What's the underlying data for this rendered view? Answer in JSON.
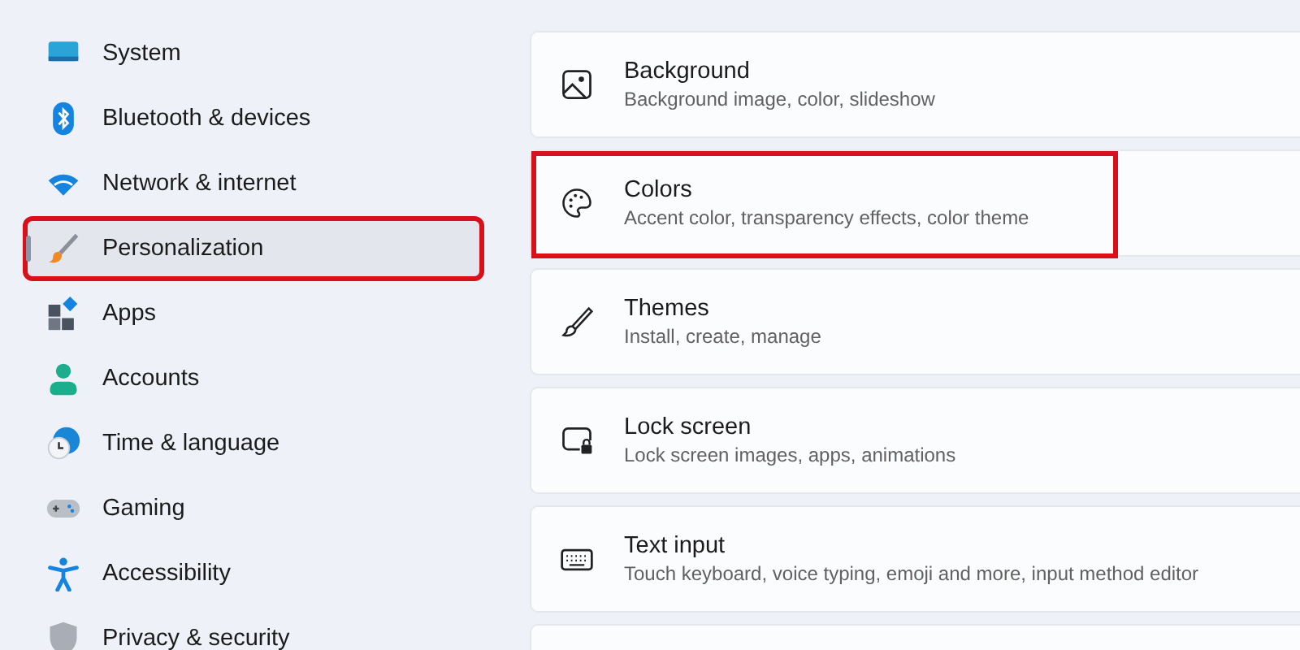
{
  "sidebar": {
    "items": [
      {
        "label": "System",
        "selected": false,
        "highlighted": false
      },
      {
        "label": "Bluetooth & devices",
        "selected": false,
        "highlighted": false
      },
      {
        "label": "Network & internet",
        "selected": false,
        "highlighted": false
      },
      {
        "label": "Personalization",
        "selected": true,
        "highlighted": true
      },
      {
        "label": "Apps",
        "selected": false,
        "highlighted": false
      },
      {
        "label": "Accounts",
        "selected": false,
        "highlighted": false
      },
      {
        "label": "Time & language",
        "selected": false,
        "highlighted": false
      },
      {
        "label": "Gaming",
        "selected": false,
        "highlighted": false
      },
      {
        "label": "Accessibility",
        "selected": false,
        "highlighted": false
      },
      {
        "label": "Privacy & security",
        "selected": false,
        "highlighted": false
      }
    ]
  },
  "cards": [
    {
      "title": "Background",
      "subtitle": "Background image, color, slideshow",
      "highlighted": false
    },
    {
      "title": "Colors",
      "subtitle": "Accent color, transparency effects, color theme",
      "highlighted": true
    },
    {
      "title": "Themes",
      "subtitle": "Install, create, manage",
      "highlighted": false
    },
    {
      "title": "Lock screen",
      "subtitle": "Lock screen images, apps, animations",
      "highlighted": false
    },
    {
      "title": "Text input",
      "subtitle": "Touch keyboard, voice typing, emoji and more, input method editor",
      "highlighted": false
    }
  ]
}
